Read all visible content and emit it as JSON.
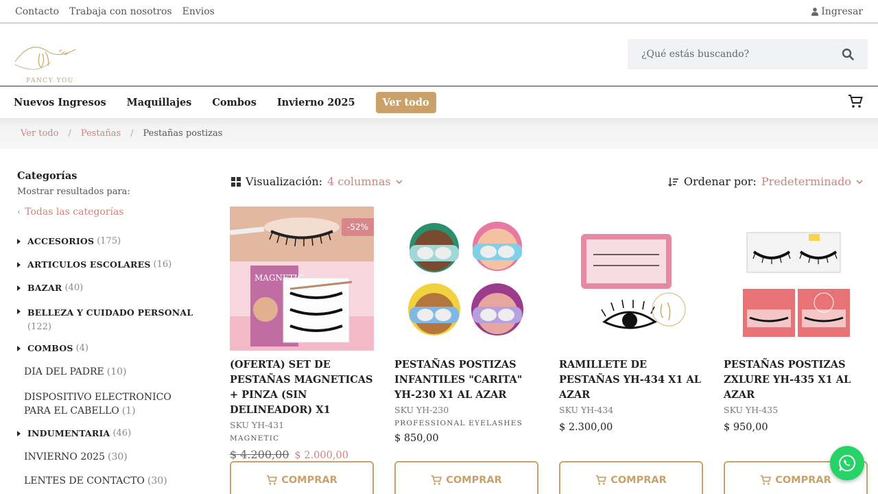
{
  "topbar": {
    "links": [
      "Contacto",
      "Trabaja con nosotros",
      "Envios"
    ],
    "login": "Ingresar"
  },
  "logo": {
    "text": "FANCY YOU"
  },
  "search": {
    "placeholder": "¿Qué estás buscando?"
  },
  "nav": {
    "items": [
      "Nuevos Ingresos",
      "Maquillajes",
      "Combos",
      "Invierno 2025"
    ],
    "cta": "Ver todo"
  },
  "breadcrumb": [
    "Ver todo",
    "Pestañas",
    "Pestañas postizas"
  ],
  "sidebar": {
    "title": "Categorías",
    "subtitle": "Mostrar resultados para:",
    "all": "Todas las categorías",
    "categories": [
      {
        "name": "ACCESORIOS",
        "count": "(175)"
      },
      {
        "name": "ARTICULOS ESCOLARES",
        "count": "(16)"
      },
      {
        "name": "BAZAR",
        "count": "(40)"
      },
      {
        "name": "BELLEZA Y CUIDADO PERSONAL",
        "count": "(122)"
      },
      {
        "name": "COMBOS",
        "count": "(4)"
      },
      {
        "name": "DIA DEL PADRE",
        "count": "(10)"
      },
      {
        "name": "DISPOSITIVO ELECTRONICO PARA EL CABELLO",
        "count": "(1)"
      },
      {
        "name": "INDUMENTARIA",
        "count": "(46)"
      },
      {
        "name": "INVIERNO 2025",
        "count": "(30)"
      },
      {
        "name": "LENTES DE CONTACTO",
        "count": "(30)"
      }
    ]
  },
  "toolbar": {
    "view_label": "Visualización:",
    "view_value": "4 columnas",
    "order_label": "Ordenar por:",
    "order_value": "Predeterminado"
  },
  "products": [
    {
      "title": "(OFERTA) SET DE PESTAÑAS MAGNETICAS + PINZA (SIN DELINEADOR) X1",
      "sku": "SKU YH-431",
      "brand": "MAGNETIC",
      "old_price": "$  4.200,00",
      "price": "$  2.000,00",
      "badge": "-52%",
      "buy": "COMPRAR"
    },
    {
      "title": "PESTAÑAS POSTIZAS INFANTILES \"CARITA\" YH-230 X1 AL AZAR",
      "sku": "SKU YH-230",
      "brand": "PROFESSIONAL EYELASHES",
      "price": "$  850,00",
      "buy": "COMPRAR"
    },
    {
      "title": "RAMILLETE DE PESTAÑAS YH-434 X1 AL AZAR",
      "sku": "SKU YH-434",
      "price": "$  2.300,00",
      "buy": "COMPRAR"
    },
    {
      "title": "PESTAÑAS POSTIZAS ZXLURE YH-435 X1 AL AZAR",
      "sku": "SKU YH-435",
      "price": "$  950,00",
      "buy": "COMPRAR"
    }
  ],
  "colors": {
    "accent": "#c9a26a",
    "link": "#c9857d",
    "whatsapp": "#25d366"
  },
  "icons": [
    "user-icon",
    "search-icon",
    "cart-icon",
    "grid-icon",
    "sort-icon",
    "whatsapp-icon"
  ]
}
